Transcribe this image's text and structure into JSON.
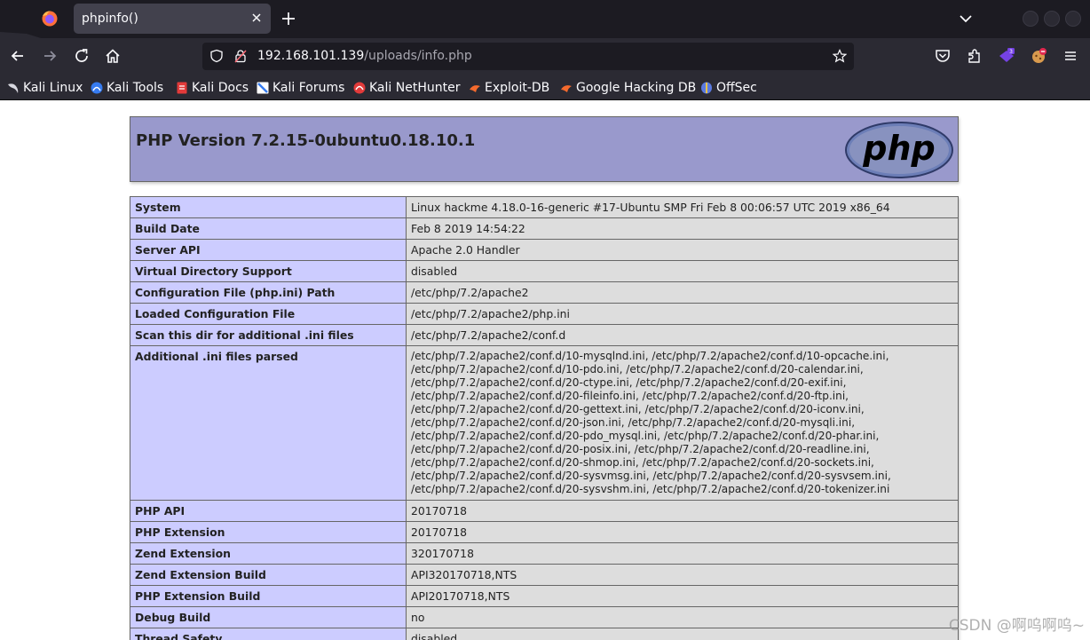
{
  "browser": {
    "tab_title": "phpinfo()",
    "url_host": "192.168.101.139",
    "url_path": "/uploads/info.php",
    "accent": "#1c1b22",
    "extensions_badge": "3",
    "bookmarks": [
      {
        "label": "Kali Linux",
        "icon": "kali-dragon-icon"
      },
      {
        "label": "Kali Tools",
        "icon": "kali-tools-icon"
      },
      {
        "label": "Kali Docs",
        "icon": "kali-docs-icon"
      },
      {
        "label": "Kali Forums",
        "icon": "kali-forums-icon"
      },
      {
        "label": "Kali NetHunter",
        "icon": "kali-nethunter-icon"
      },
      {
        "label": "Exploit-DB",
        "icon": "exploit-db-icon"
      },
      {
        "label": "Google Hacking DB",
        "icon": "ghdb-icon"
      },
      {
        "label": "OffSec",
        "icon": "offsec-icon"
      }
    ]
  },
  "page": {
    "version_title": "PHP Version 7.2.15-0ubuntu0.18.10.1",
    "logo_text": "php",
    "header_color": "#9999cc",
    "key_color": "#ccccff",
    "value_color": "#dddddd",
    "rows": [
      {
        "key": "System",
        "value": "Linux hackme 4.18.0-16-generic #17-Ubuntu SMP Fri Feb 8 00:06:57 UTC 2019 x86_64"
      },
      {
        "key": "Build Date",
        "value": "Feb 8 2019 14:54:22"
      },
      {
        "key": "Server API",
        "value": "Apache 2.0 Handler"
      },
      {
        "key": "Virtual Directory Support",
        "value": "disabled"
      },
      {
        "key": "Configuration File (php.ini) Path",
        "value": "/etc/php/7.2/apache2"
      },
      {
        "key": "Loaded Configuration File",
        "value": "/etc/php/7.2/apache2/php.ini"
      },
      {
        "key": "Scan this dir for additional .ini files",
        "value": "/etc/php/7.2/apache2/conf.d"
      },
      {
        "key": "Additional .ini files parsed",
        "value": "/etc/php/7.2/apache2/conf.d/10-mysqlnd.ini, /etc/php/7.2/apache2/conf.d/10-opcache.ini, /etc/php/7.2/apache2/conf.d/10-pdo.ini, /etc/php/7.2/apache2/conf.d/20-calendar.ini, /etc/php/7.2/apache2/conf.d/20-ctype.ini, /etc/php/7.2/apache2/conf.d/20-exif.ini, /etc/php/7.2/apache2/conf.d/20-fileinfo.ini, /etc/php/7.2/apache2/conf.d/20-ftp.ini, /etc/php/7.2/apache2/conf.d/20-gettext.ini, /etc/php/7.2/apache2/conf.d/20-iconv.ini, /etc/php/7.2/apache2/conf.d/20-json.ini, /etc/php/7.2/apache2/conf.d/20-mysqli.ini, /etc/php/7.2/apache2/conf.d/20-pdo_mysql.ini, /etc/php/7.2/apache2/conf.d/20-phar.ini, /etc/php/7.2/apache2/conf.d/20-posix.ini, /etc/php/7.2/apache2/conf.d/20-readline.ini, /etc/php/7.2/apache2/conf.d/20-shmop.ini, /etc/php/7.2/apache2/conf.d/20-sockets.ini, /etc/php/7.2/apache2/conf.d/20-sysvmsg.ini, /etc/php/7.2/apache2/conf.d/20-sysvsem.ini, /etc/php/7.2/apache2/conf.d/20-sysvshm.ini, /etc/php/7.2/apache2/conf.d/20-tokenizer.ini"
      },
      {
        "key": "PHP API",
        "value": "20170718"
      },
      {
        "key": "PHP Extension",
        "value": "20170718"
      },
      {
        "key": "Zend Extension",
        "value": "320170718"
      },
      {
        "key": "Zend Extension Build",
        "value": "API320170718,NTS"
      },
      {
        "key": "PHP Extension Build",
        "value": "API20170718,NTS"
      },
      {
        "key": "Debug Build",
        "value": "no"
      },
      {
        "key": "Thread Safety",
        "value": "disabled"
      }
    ]
  },
  "watermark": "CSDN @啊呜啊呜~"
}
